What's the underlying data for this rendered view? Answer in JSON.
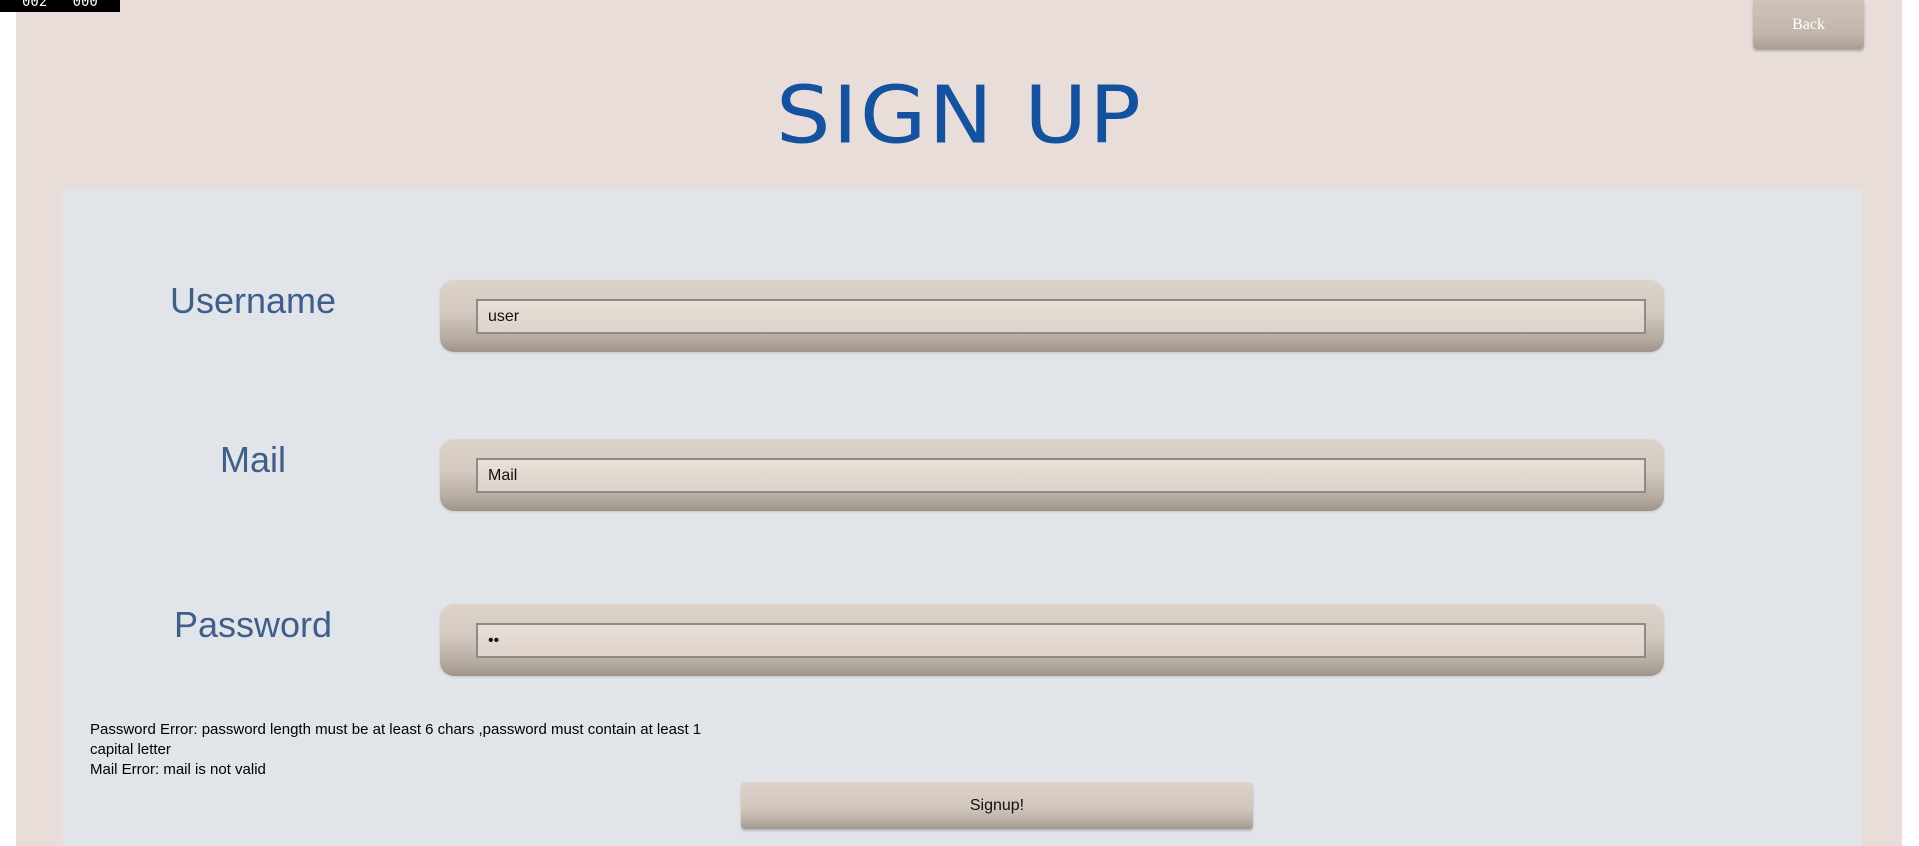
{
  "debug_counter": "002   000",
  "header": {
    "back_label": "Back",
    "title": "SIGN UP"
  },
  "form": {
    "username": {
      "label": "Username",
      "value": "user"
    },
    "mail": {
      "label": "Mail",
      "value": "Mail"
    },
    "password": {
      "label": "Password",
      "value": "••"
    }
  },
  "errors": {
    "password_error_line1": "Password Error: password length must be at least 6 chars ,password must contain at least 1",
    "password_error_line2": "capital letter",
    "mail_error": "Mail Error: mail is not valid"
  },
  "signup_label": "Signup!",
  "colors": {
    "title": "#1352a0",
    "label": "#3e5e8b",
    "window_bg": "#e8ddd8",
    "panel_bg": "#e1e5e9"
  }
}
